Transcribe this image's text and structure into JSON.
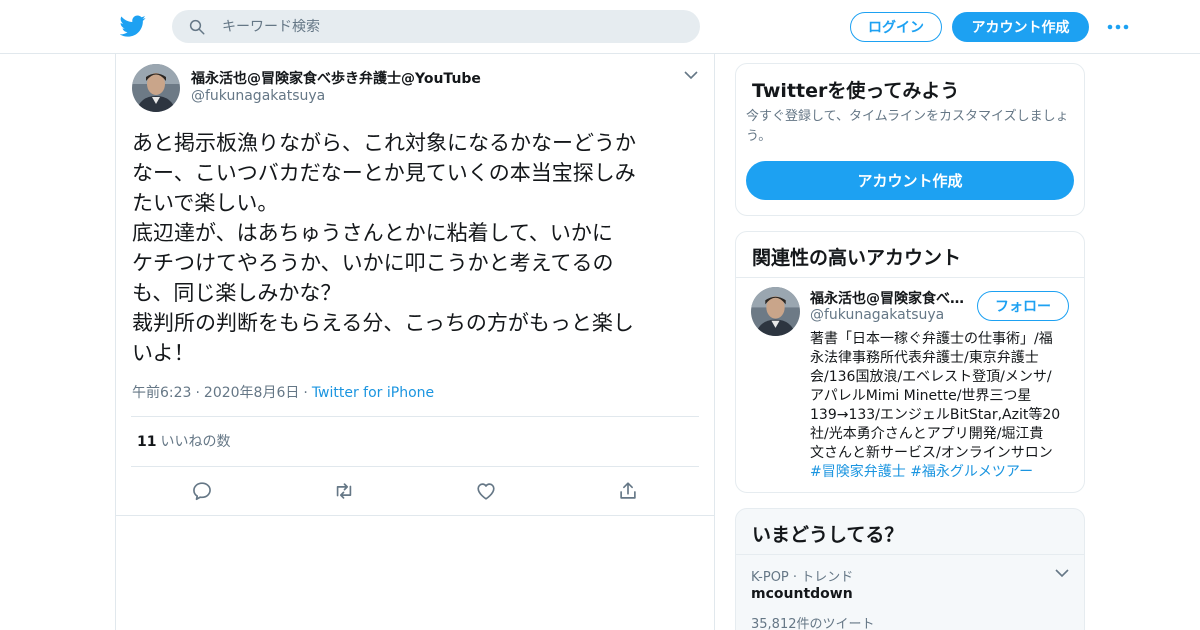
{
  "header": {
    "search_placeholder": "キーワード検索",
    "login_label": "ログイン",
    "signup_label": "アカウント作成",
    "icons": {
      "logo": "twitter-bird-icon",
      "search": "search-icon",
      "more": "more-dots-icon"
    },
    "brand_color": "#1da1f2"
  },
  "tweet": {
    "author_name": "福永活也@冒険家食べ歩き弁護士@YouTube",
    "author_handle": "@fukunagakatsuya",
    "lines": [
      "あと掲示板漁りながら、これ対象になるかなーどうか",
      "なー、こいつバカだなーとか見ていくの本当宝探しみ",
      "たいで楽しい。",
      "底辺達が、はあちゅうさんとかに粘着して、いかに",
      "ケチつけてやろうか、いかに叩こうかと考えてるの",
      "も、同じ楽しみかな？",
      "裁判所の判断をもらえる分、こっちの方がもっと楽し",
      "いよ！"
    ],
    "time": "午前6:23",
    "date": "2020年8月6日",
    "separator": "·",
    "source": "Twitter for iPhone",
    "like_count": "11",
    "like_label": "いいねの数",
    "actions": [
      "reply-icon",
      "retweet-icon",
      "like-icon",
      "share-icon"
    ]
  },
  "signup_card": {
    "title": "Twitterを使ってみよう",
    "subtitle_lines": [
      "今すぐ登録して、タイムラインをカスタマイズしましょ",
      "う。"
    ],
    "button_label": "アカウント作成"
  },
  "related_card": {
    "title": "関連性の高いアカウント",
    "account": {
      "name": "福永活也@冒険家食べ歩き弁護士@YouTube",
      "handle": "@fukunagakatsuya",
      "follow_label": "フォロー",
      "bio_lines": [
        "著書「日本一稼ぐ弁護士の仕事術」/福",
        "永法律事務所代表弁護士/東京弁護士",
        "会/136国放浪/エベレスト登頂/メンサ/",
        "アパレルMimi Minette/世界三つ星",
        "139→133/エンジェルBitStar,Azit等20",
        "社/光本勇介さんとアプリ開発/堀江貴",
        "文さんと新サービス/オンラインサロン"
      ],
      "hashtags": [
        "#冒険家弁護士",
        "#福永グルメツアー"
      ]
    }
  },
  "trends_card": {
    "title": "いまどうしてる？",
    "trend": {
      "category": "K-POP",
      "separator": "·",
      "label": "トレンド",
      "name": "mcountdown",
      "count": "35,812件のツイート"
    }
  }
}
